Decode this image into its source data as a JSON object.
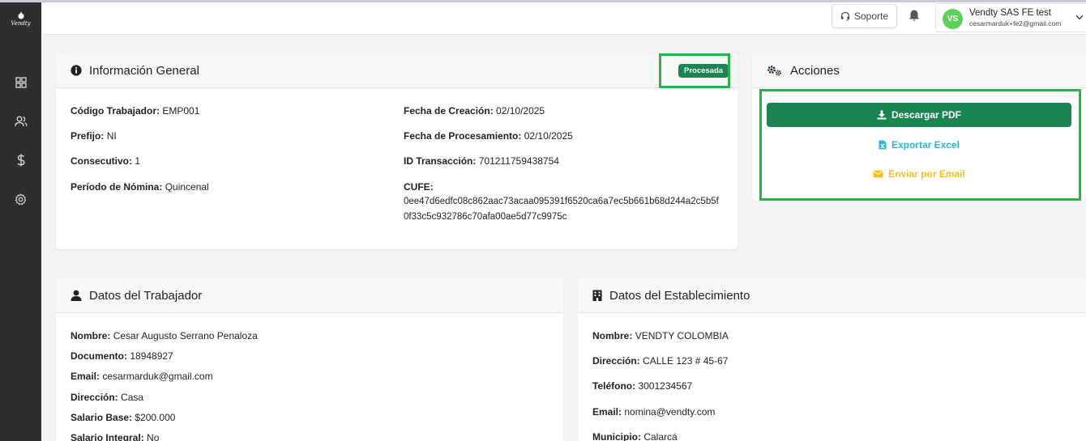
{
  "app": {
    "logo_text": "Vendty"
  },
  "sidebar": {
    "items": [
      {
        "name": "dashboard",
        "icon": "grid-icon"
      },
      {
        "name": "users",
        "icon": "users-icon"
      },
      {
        "name": "finance",
        "icon": "dollar-icon"
      },
      {
        "name": "settings",
        "icon": "gear-icon"
      }
    ]
  },
  "header": {
    "support_label": "Soporte",
    "user_name": "Vendty SAS FE test",
    "user_email": "cesarmarduk+fe2@gmail.com",
    "avatar_initials": "VS"
  },
  "general": {
    "title": "Información General",
    "status": "Procesada",
    "codigo_label": "Código Trabajador:",
    "codigo_value": "EMP001",
    "prefijo_label": "Prefijo:",
    "prefijo_value": "NI",
    "consecutivo_label": "Consecutivo:",
    "consecutivo_value": "1",
    "periodo_label": "Período de Nómina:",
    "periodo_value": "Quincenal",
    "fecha_creacion_label": "Fecha de Creación:",
    "fecha_creacion_value": "02/10/2025",
    "fecha_proc_label": "Fecha de Procesamiento:",
    "fecha_proc_value": "02/10/2025",
    "id_trans_label": "ID Transacción:",
    "id_trans_value": "701211759438754",
    "cufe_label": "CUFE:",
    "cufe_line1": "0ee47d6edfc08c862aac73acaa095391f6520ca6a7ec5b661b68d244a2c5b5f",
    "cufe_line2": "0f33c5c932786c70afa00ae5d77c9975c"
  },
  "acciones": {
    "title": "Acciones",
    "pdf_label": "Descargar PDF",
    "excel_label": "Exportar Excel",
    "email_label": "Enviar por Email"
  },
  "trabajador": {
    "title": "Datos del Trabajador",
    "nombre_label": "Nombre:",
    "nombre_value": "Cesar Augusto Serrano Penaloza",
    "documento_label": "Documento:",
    "documento_value": "18948927",
    "email_label": "Email:",
    "email_value": "cesarmarduk@gmail.com",
    "direccion_label": "Dirección:",
    "direccion_value": "Casa",
    "salario_label": "Salario Base:",
    "salario_value": "$200.000",
    "integral_label": "Salario Integral:",
    "integral_value": "No"
  },
  "establecimiento": {
    "title": "Datos del Establecimiento",
    "nombre_label": "Nombre:",
    "nombre_value": "VENDTY COLOMBIA",
    "direccion_label": "Dirección:",
    "direccion_value": "CALLE 123 # 45-67",
    "telefono_label": "Teléfono:",
    "telefono_value": "3001234567",
    "email_label": "Email:",
    "email_value": "nomina@vendty.com",
    "municipio_label": "Municipio:",
    "municipio_value": "Calarcá"
  },
  "colors": {
    "primary_green": "#1a8553",
    "highlight_green": "#2db14a",
    "excel_cyan": "#2bb8d6",
    "email_yellow": "#f4c020",
    "sidebar_bg": "#2e2e2e",
    "avatar_green": "#5dd05a"
  }
}
